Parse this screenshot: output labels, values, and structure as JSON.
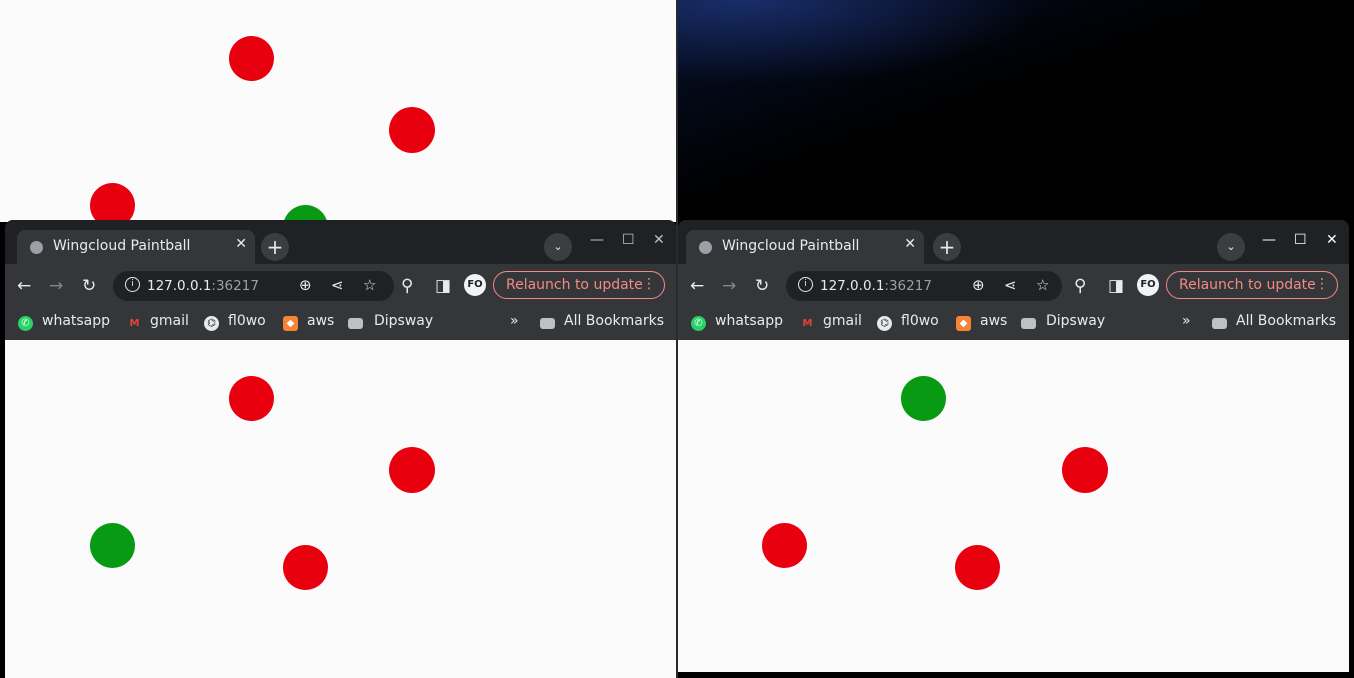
{
  "background_left": {
    "dots": [
      {
        "color": "red"
      },
      {
        "color": "red"
      },
      {
        "color": "red"
      },
      {
        "color": "green"
      }
    ]
  },
  "colors": {
    "red": "#e8000f",
    "green": "#079a12",
    "chrome_dark": "#202124",
    "chrome_toolbar": "#35363a",
    "relaunch": "#f28b82"
  },
  "windows": [
    {
      "tab_title": "Wingcloud Paintball",
      "tab_close": "✕",
      "new_tab": "+",
      "tab_search": "⌄",
      "url_host": "127.0.0.1",
      "url_port": ":36217",
      "relaunch_label": "Relaunch to update",
      "relaunch_more": "⋮",
      "profile": "FO",
      "bookmarks": [
        {
          "label": "whatsapp",
          "icon": "whatsapp-icon"
        },
        {
          "label": "gmail",
          "icon": "gmail-icon"
        },
        {
          "label": "fl0wo",
          "icon": "github-icon"
        },
        {
          "label": "aws",
          "icon": "aws-icon"
        },
        {
          "label": "Dipsway",
          "icon": "folder-icon"
        }
      ],
      "bookmarks_overflow": "»",
      "all_bookmarks": "All Bookmarks",
      "game_dots": [
        {
          "color": "red"
        },
        {
          "color": "red"
        },
        {
          "color": "green"
        },
        {
          "color": "red"
        }
      ]
    },
    {
      "tab_title": "Wingcloud Paintball",
      "tab_close": "✕",
      "new_tab": "+",
      "tab_search": "⌄",
      "url_host": "127.0.0.1",
      "url_port": ":36217",
      "relaunch_label": "Relaunch to update",
      "relaunch_more": "⋮",
      "profile": "FO",
      "bookmarks": [
        {
          "label": "whatsapp",
          "icon": "whatsapp-icon"
        },
        {
          "label": "gmail",
          "icon": "gmail-icon"
        },
        {
          "label": "fl0wo",
          "icon": "github-icon"
        },
        {
          "label": "aws",
          "icon": "aws-icon"
        },
        {
          "label": "Dipsway",
          "icon": "folder-icon"
        }
      ],
      "bookmarks_overflow": "»",
      "all_bookmarks": "All Bookmarks",
      "game_dots": [
        {
          "color": "green"
        },
        {
          "color": "red"
        },
        {
          "color": "red"
        },
        {
          "color": "red"
        }
      ]
    }
  ]
}
